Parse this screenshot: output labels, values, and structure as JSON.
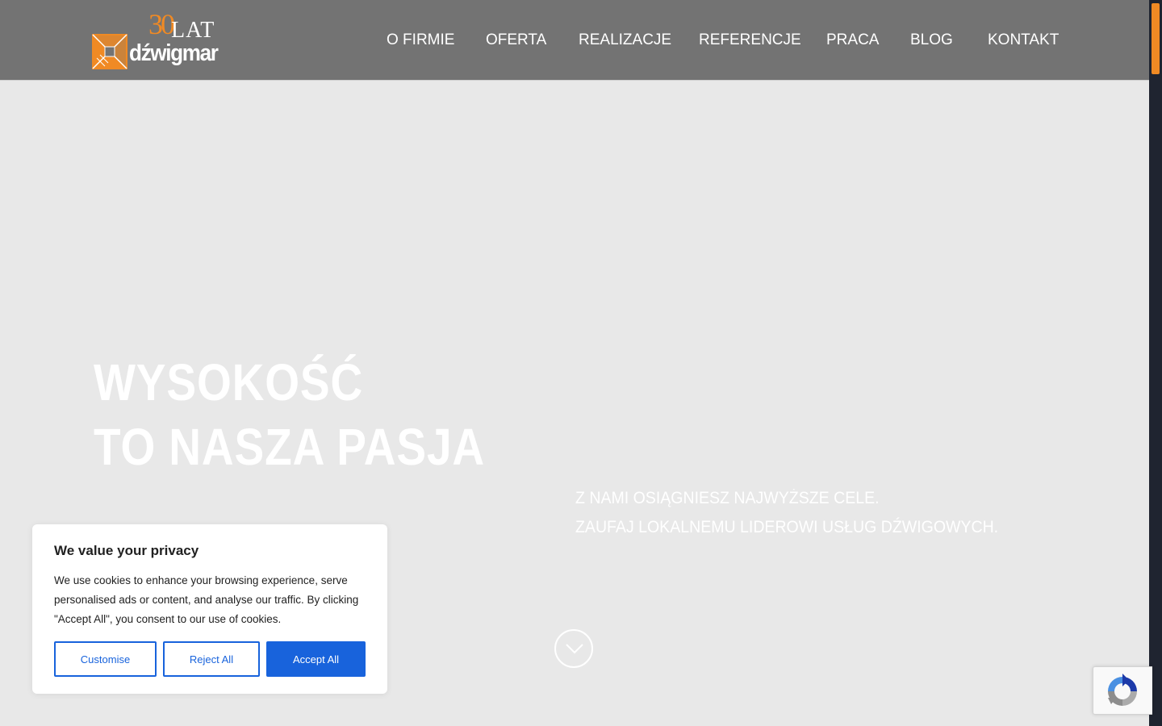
{
  "logo": {
    "years_number": "30",
    "years_word": "LAT",
    "brand": "dźwigmar",
    "colors": {
      "accent": "#f08a24",
      "text": "#ffffff"
    }
  },
  "nav": {
    "items": [
      {
        "label": "O FIRMIE"
      },
      {
        "label": "OFERTA"
      },
      {
        "label": "REALIZACJE"
      },
      {
        "label": "REFERENCJE"
      },
      {
        "label": "PRACA"
      },
      {
        "label": "BLOG"
      },
      {
        "label": "KONTAKT"
      }
    ]
  },
  "hero": {
    "title_line1": "WYSOKOŚĆ",
    "title_line2": "TO NASZA PASJA",
    "subtitle_line1": "Z NAMI OSIĄGNIESZ NAJWYŻSZE CELE.",
    "subtitle_line2": "ZAUFAJ LOKALNEMU LIDEROWI USŁUG DŹWIGOWYCH.",
    "scroll_icon": "chevron-down-icon"
  },
  "cookie_banner": {
    "title": "We value your privacy",
    "text": "We use cookies to enhance your browsing experience, serve personalised ads or content, and analyse our traffic. By clicking \"Accept All\", you consent to our use of cookies.",
    "customise_label": "Customise",
    "reject_label": "Reject All",
    "accept_label": "Accept All",
    "button_color": "#1863dc"
  },
  "recaptcha": {
    "icon": "recaptcha-icon"
  },
  "colors": {
    "header_bg": "#737373",
    "page_bg": "#e8e8e8",
    "accent": "#f08a24",
    "scrollbar_track": "#1f2430"
  }
}
